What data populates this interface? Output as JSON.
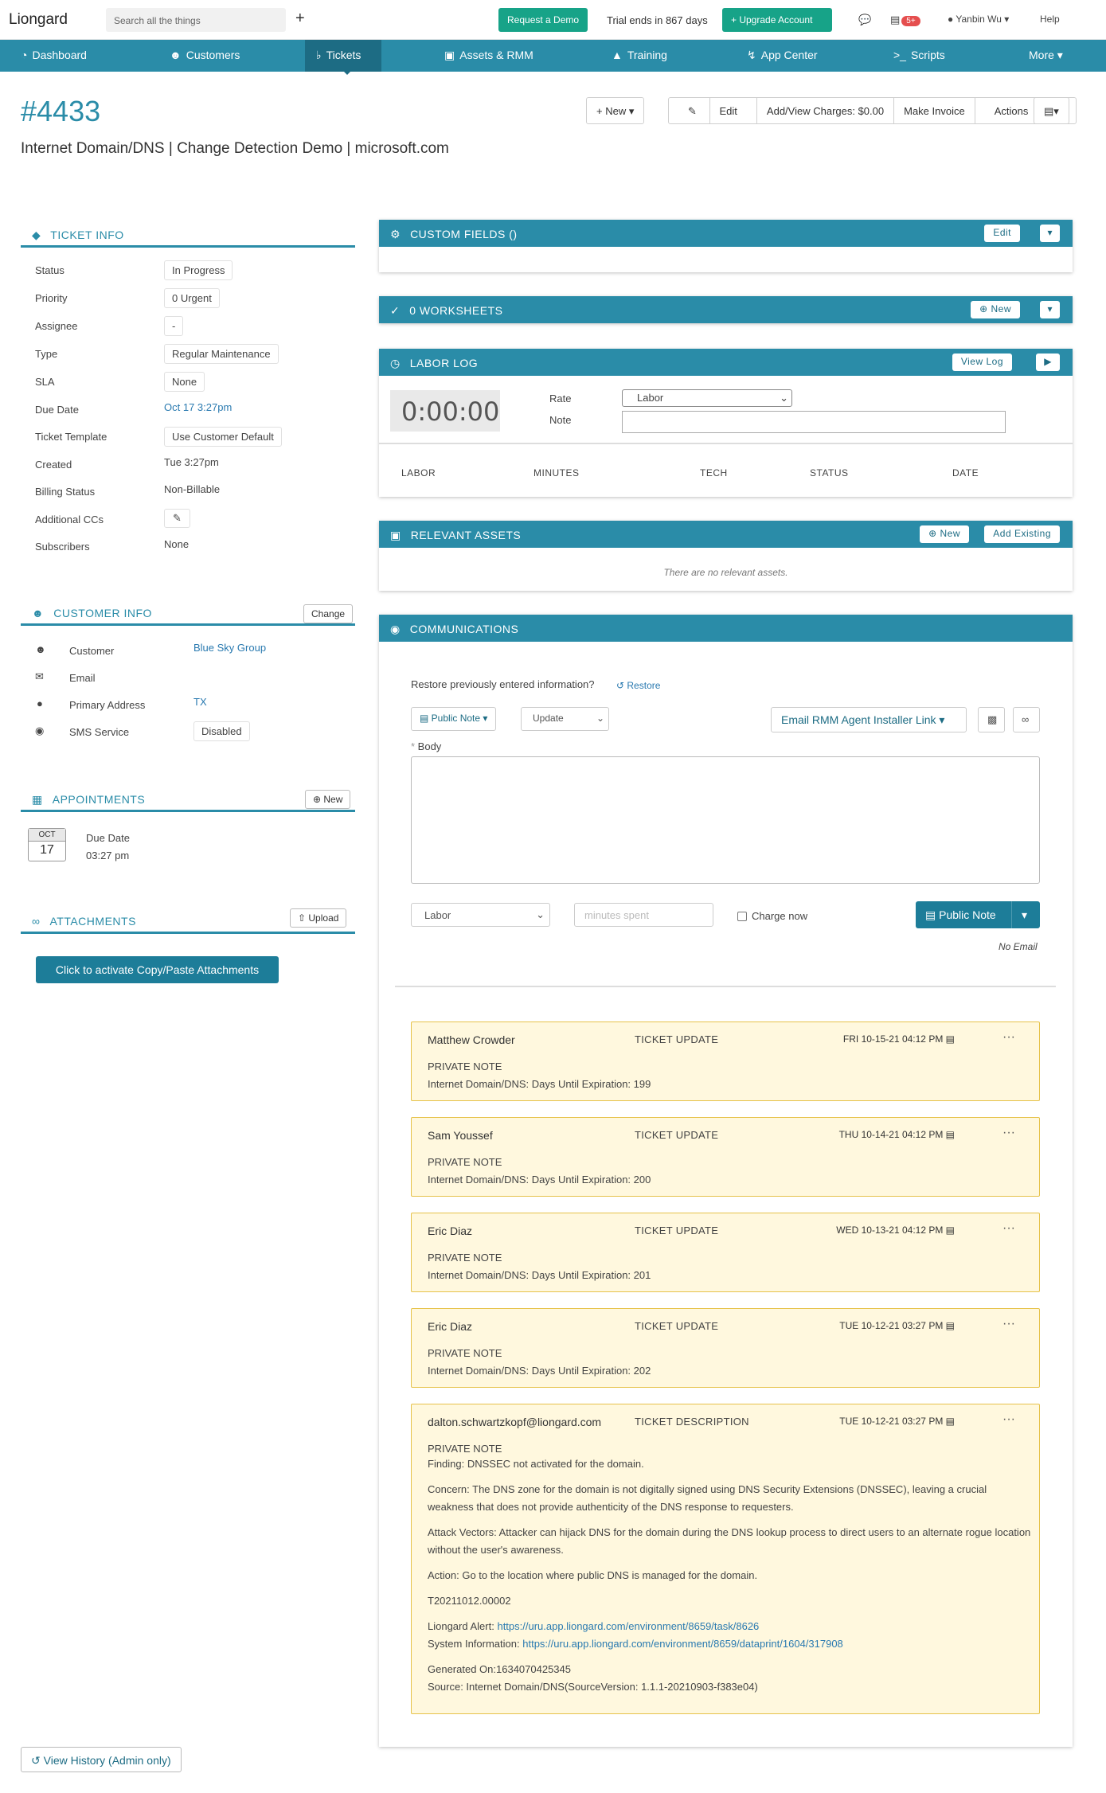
{
  "topbar": {
    "logo": "Liongard",
    "search_placeholder": "Search all the things",
    "request_demo": "Request a Demo",
    "trial": "Trial ends in 867 days",
    "upgrade": "Upgrade Account",
    "badge": "5+",
    "user": "Yanbin Wu",
    "help": "Help"
  },
  "nav": {
    "dashboard": "Dashboard",
    "customers": "Customers",
    "tickets": "Tickets",
    "assets": "Assets & RMM",
    "training": "Training",
    "appcenter": "App Center",
    "scripts": "Scripts",
    "more": "More"
  },
  "ticket": {
    "number": "#4433",
    "subject": "Internet Domain/DNS | Change Detection Demo | microsoft.com"
  },
  "header_buttons": {
    "new": "New",
    "edit": "Edit",
    "charges": "Add/View Charges: $0.00",
    "invoice": "Make Invoice",
    "actions": "Actions"
  },
  "ticket_info": {
    "title": "TICKET INFO",
    "rows": [
      {
        "label": "Status",
        "value": "In Progress"
      },
      {
        "label": "Priority",
        "value": "0 Urgent"
      },
      {
        "label": "Assignee",
        "value": "-"
      },
      {
        "label": "Type",
        "value": "Regular Maintenance"
      },
      {
        "label": "SLA",
        "value": "None"
      },
      {
        "label": "Due Date",
        "value": "Oct 17 3:27pm"
      },
      {
        "label": "Ticket Template",
        "value": "Use Customer Default"
      },
      {
        "label": "Created",
        "value": "Tue 3:27pm"
      },
      {
        "label": "Billing Status",
        "value": "Non-Billable"
      },
      {
        "label": "Additional CCs",
        "value": ""
      },
      {
        "label": "Subscribers",
        "value": "None"
      }
    ]
  },
  "customer_info": {
    "title": "CUSTOMER INFO",
    "change": "Change",
    "rows": [
      {
        "label": "Customer",
        "value": "Blue Sky Group"
      },
      {
        "label": "Email",
        "value": ""
      },
      {
        "label": "Primary Address",
        "value": "TX"
      },
      {
        "label": "SMS Service",
        "value": "Disabled"
      }
    ]
  },
  "appointments": {
    "title": "APPOINTMENTS",
    "new": "New",
    "cal_month": "OCT",
    "cal_day": "17",
    "label": "Due Date",
    "time": "03:27 pm"
  },
  "attachments": {
    "title": "ATTACHMENTS",
    "upload": "Upload",
    "activate": "Click to activate Copy/Paste Attachments"
  },
  "history": "View History (Admin only)",
  "custom_fields": {
    "title": "CUSTOM FIELDS ()",
    "edit": "Edit"
  },
  "worksheets": {
    "title": "0 WORKSHEETS",
    "new": "New"
  },
  "labor_log": {
    "title": "LABOR LOG",
    "view": "View Log",
    "timer": "0:00:00",
    "rate_label": "Rate",
    "rate_value": "Labor",
    "note_label": "Note",
    "cols": [
      "LABOR",
      "MINUTES",
      "TECH",
      "STATUS",
      "DATE"
    ]
  },
  "relevant_assets": {
    "title": "RELEVANT ASSETS",
    "new": "New",
    "add": "Add Existing",
    "empty": "There are no relevant assets."
  },
  "communications": {
    "title": "COMMUNICATIONS",
    "restore_q": "Restore previously entered information?",
    "restore": "Restore",
    "public_note": "Public Note",
    "update": "Update",
    "rmm_link": "Email RMM Agent Installer Link",
    "body_label": "Body",
    "labor": "Labor",
    "minutes_placeholder": "minutes spent",
    "charge_now": "Charge now",
    "submit": "Public Note",
    "no_email": "No Email"
  },
  "notes": [
    {
      "author": "Matthew Crowder",
      "type": "TICKET UPDATE",
      "date": "FRI 10-15-21 04:12 PM",
      "kind": "PRIVATE NOTE",
      "body": "Internet Domain/DNS: Days Until Expiration: 199"
    },
    {
      "author": "Sam Youssef",
      "type": "TICKET UPDATE",
      "date": "THU 10-14-21 04:12 PM",
      "kind": "PRIVATE NOTE",
      "body": "Internet Domain/DNS: Days Until Expiration: 200"
    },
    {
      "author": "Eric Diaz",
      "type": "TICKET UPDATE",
      "date": "WED 10-13-21 04:12 PM",
      "kind": "PRIVATE NOTE",
      "body": "Internet Domain/DNS: Days Until Expiration: 201"
    },
    {
      "author": "Eric Diaz",
      "type": "TICKET UPDATE",
      "date": "TUE 10-12-21 03:27 PM",
      "kind": "PRIVATE NOTE",
      "body": "Internet Domain/DNS: Days Until Expiration: 202"
    }
  ],
  "description": {
    "author": "dalton.schwartzkopf@liongard.com",
    "type": "TICKET DESCRIPTION",
    "date": "TUE 10-12-21 03:27 PM",
    "kind": "PRIVATE NOTE",
    "finding": "Finding: DNSSEC not activated for the domain.",
    "concern": "Concern: The DNS zone for the domain is not digitally signed using DNS Security Extensions (DNSSEC), leaving a crucial weakness that does not provide authenticity of the DNS response to requesters.",
    "attack": "Attack Vectors: Attacker can hijack DNS for the domain during the DNS lookup process to direct users to an alternate rogue location without the user's awareness.",
    "action": "Action: Go to the location where public DNS is managed for the domain.",
    "ref": "T20211012.00002",
    "alert_label": "Liongard Alert:",
    "alert_url": "https://uru.app.liongard.com/environment/8659/task/8626",
    "sys_label": "System Information:",
    "sys_url": "https://uru.app.liongard.com/environment/8659/dataprint/1604/317908",
    "generated": "Generated On:1634070425345",
    "source": "Source: Internet Domain/DNS(SourceVersion: 1.1.1-20210903-f383e04)"
  },
  "colors": {
    "brand": "#2a8ca8",
    "dark": "#1d6c84",
    "green": "#17a388",
    "note_bg": "#fff8de"
  }
}
